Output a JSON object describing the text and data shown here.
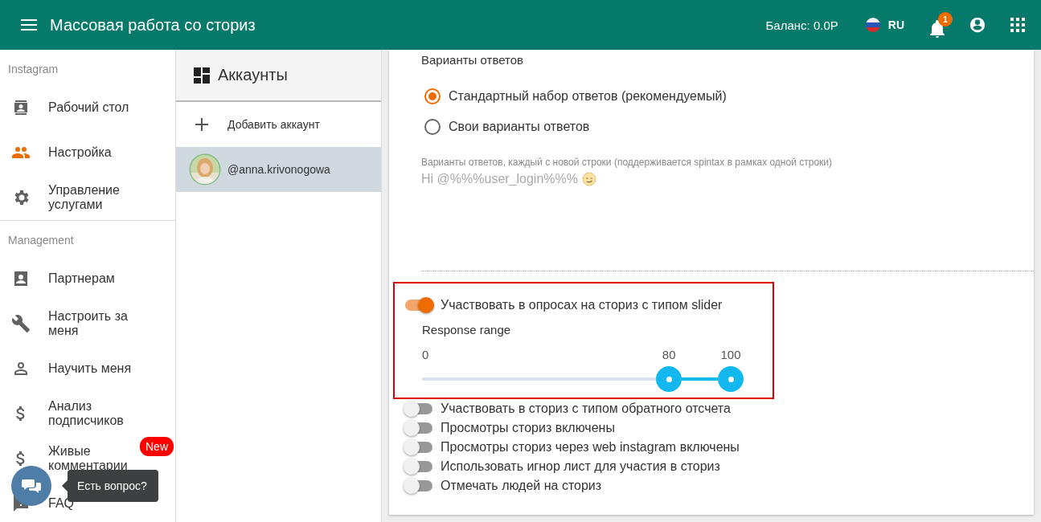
{
  "header": {
    "title": "Массовая работа со сториз",
    "balance": "Баланс: 0.0Р",
    "language": "RU",
    "notification_count": "1"
  },
  "sidebar": {
    "sections": [
      {
        "title": "Instagram",
        "items": [
          {
            "label": "Рабочий стол",
            "selected": false
          },
          {
            "label": "Настройка",
            "selected": true
          },
          {
            "label": "Управление услугами",
            "selected": false
          }
        ]
      },
      {
        "title": "Management",
        "items": [
          {
            "label": "Партнерам",
            "selected": false
          },
          {
            "label": "Настроить за меня",
            "selected": false
          },
          {
            "label": "Научить меня",
            "selected": false
          },
          {
            "label": "Анализ подписчиков",
            "selected": false
          },
          {
            "label": "Живые комментарии",
            "selected": false,
            "badge": "New"
          },
          {
            "label": "FAQ",
            "selected": false
          }
        ]
      }
    ]
  },
  "chat": {
    "tooltip": "Есть вопрос?"
  },
  "accounts": {
    "title": "Аккаунты",
    "add_label": "Добавить аккаунт",
    "items": [
      {
        "handle": "@anna.krivonogowa",
        "selected": true
      }
    ]
  },
  "replies": {
    "title": "Варианты ответов",
    "options": [
      {
        "label": "Стандартный набор ответов (рекомендуемый)",
        "selected": true
      },
      {
        "label": "Свои варианты ответов",
        "selected": false
      }
    ],
    "field_label": "Варианты ответов, каждый с новой строки (поддерживается spintax в рамках одной строки)",
    "placeholder": "Hi @%%%user_login%%%"
  },
  "toggles": [
    {
      "kind": "slider",
      "label": "Участвовать в опросах на сториз с типом slider",
      "on": true,
      "highlighted": true,
      "slider": {
        "label": "Response range",
        "min_label": "0",
        "thumbs": [
          {
            "value": "80",
            "level": 0.8
          },
          {
            "value": "100",
            "level": 1
          }
        ]
      }
    },
    {
      "kind": "plain",
      "label": "Участвовать в сториз с типом обратного отсчета",
      "on": false
    },
    {
      "kind": "plain",
      "label": "Просмотры сториз включены",
      "on": false
    },
    {
      "kind": "plain",
      "label": "Просмотры сториз через web instagram включены",
      "on": false
    },
    {
      "kind": "plain",
      "label": "Использовать игнор лист для участия в сториз",
      "on": false
    },
    {
      "kind": "plain",
      "label": "Отмечать людей на сториз",
      "on": false
    }
  ]
}
